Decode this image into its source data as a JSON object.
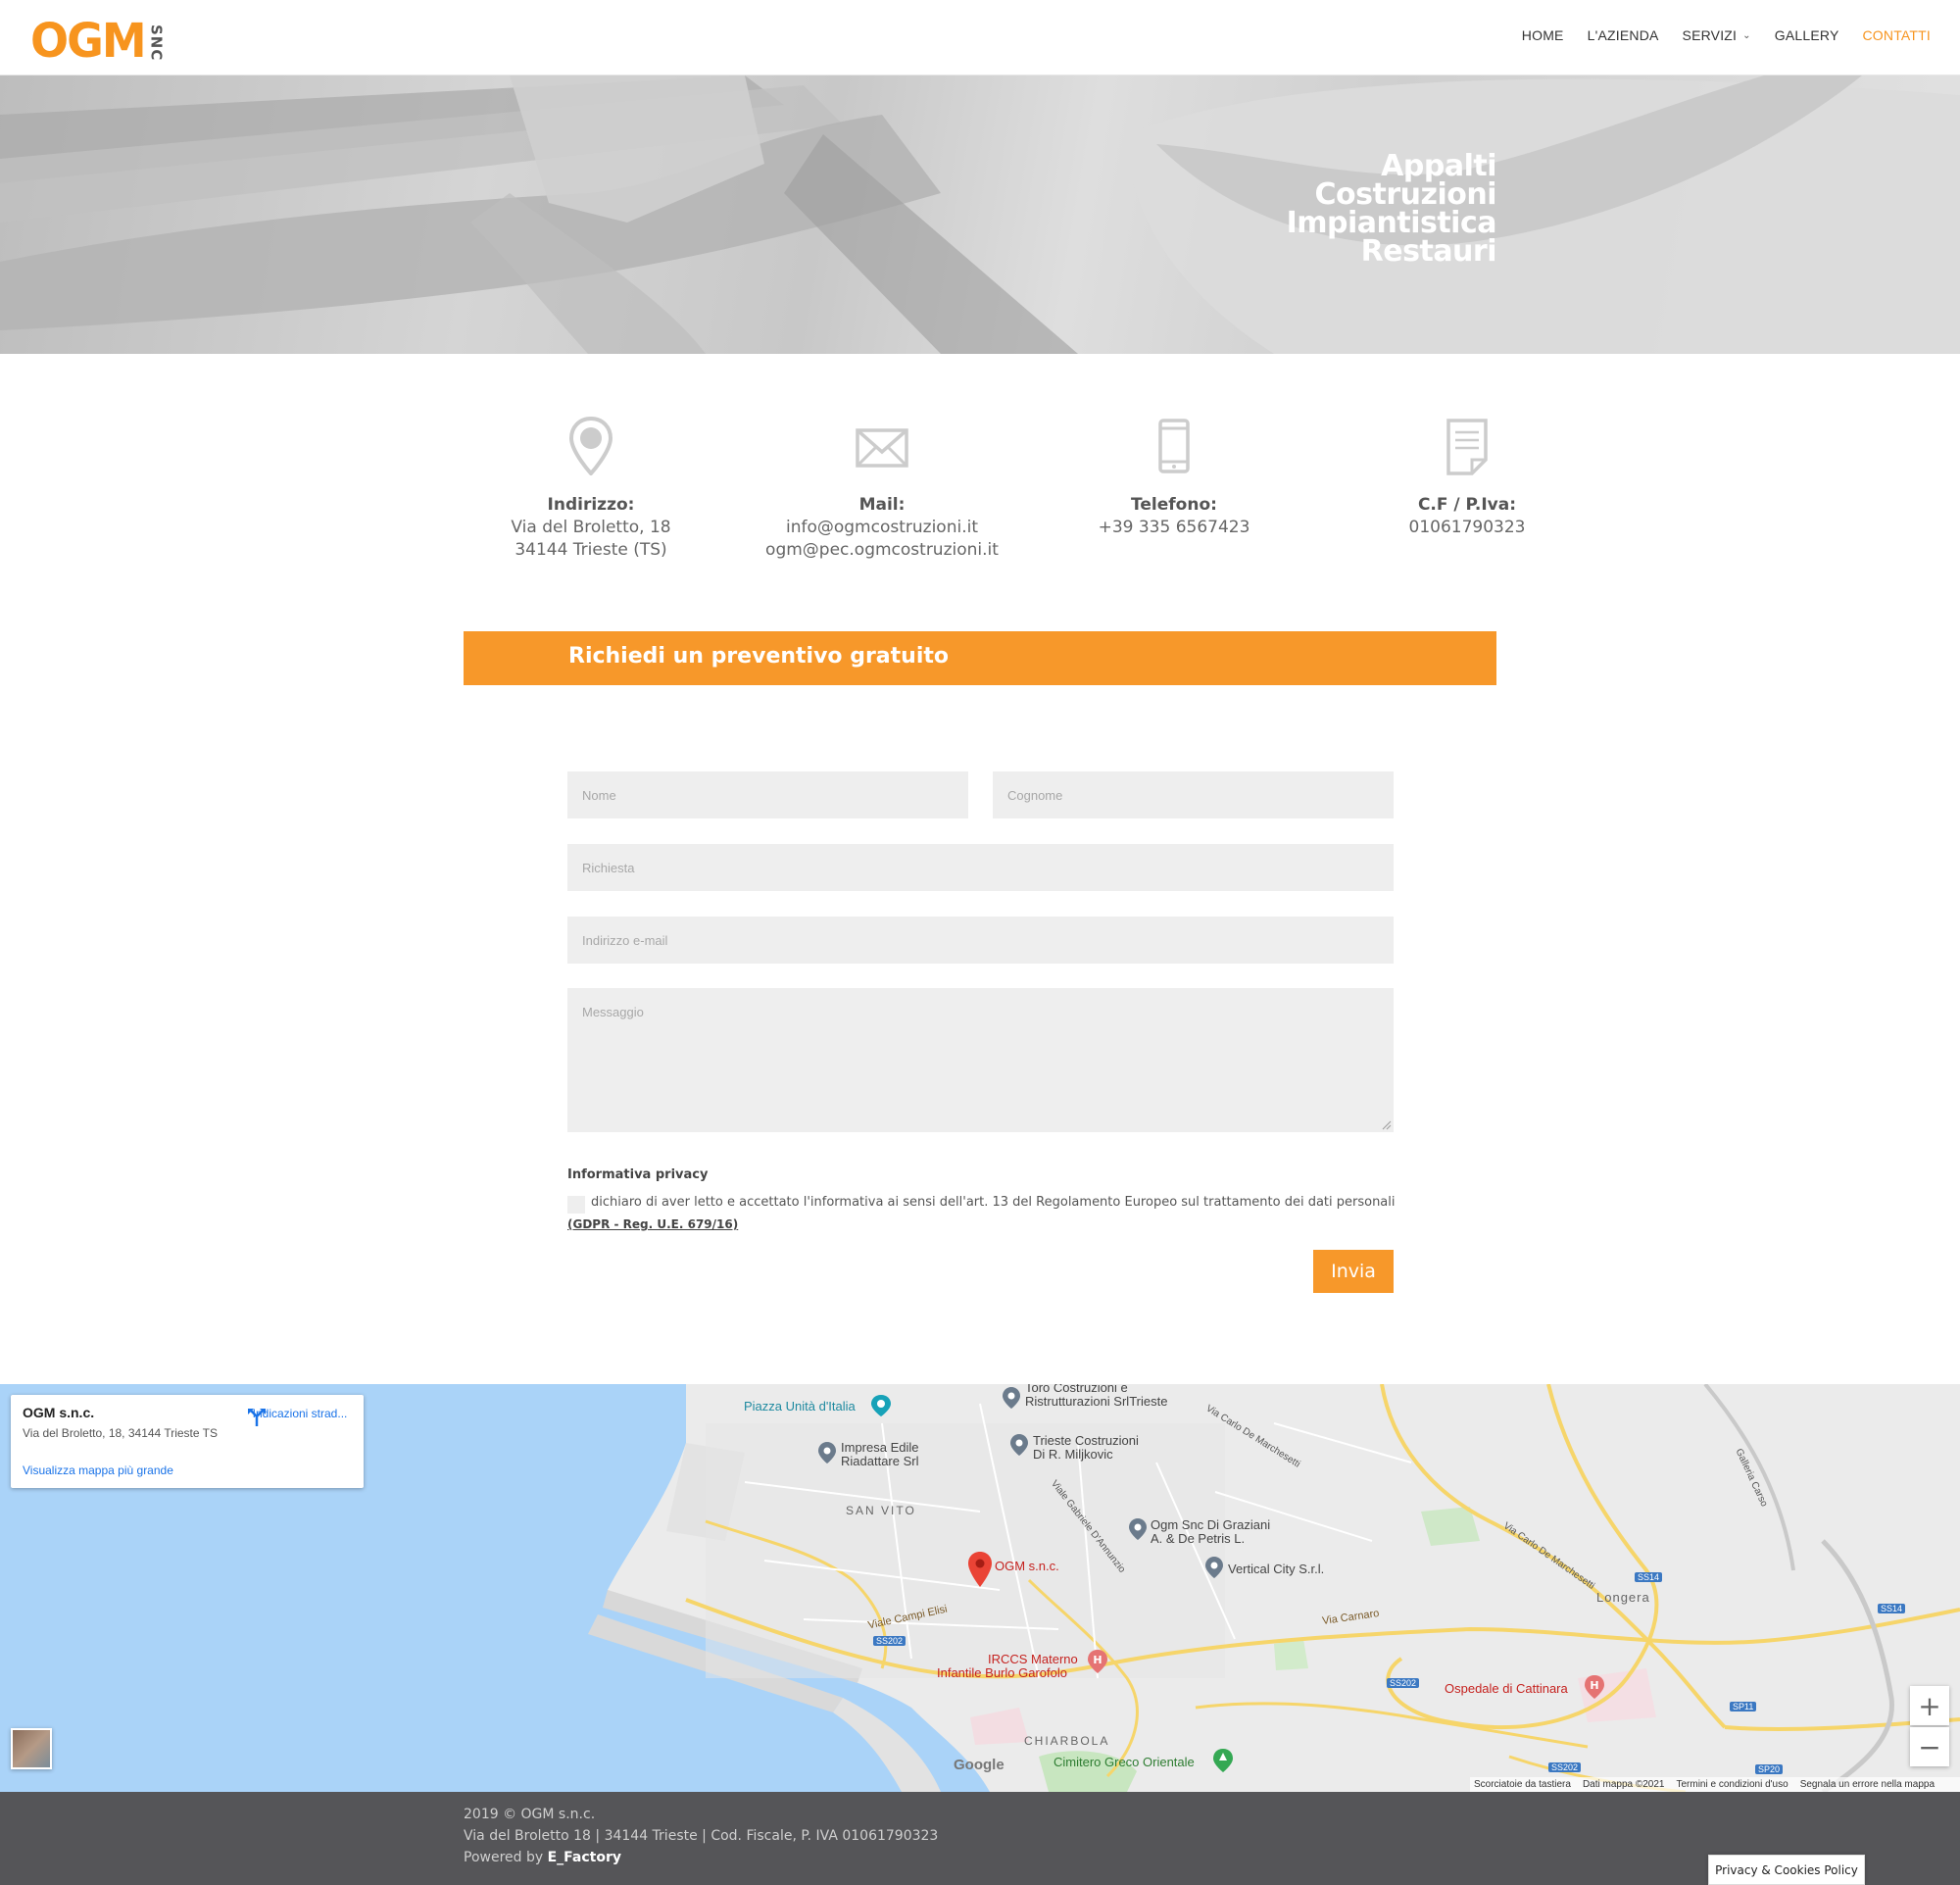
{
  "brand": {
    "logo_text": "OGM",
    "logo_sub": "SNC",
    "accent": "#f7941e",
    "banner_color": "#f7982a"
  },
  "nav": {
    "items": [
      {
        "label": "HOME"
      },
      {
        "label": "L'AZIENDA"
      },
      {
        "label": "SERVIZI"
      },
      {
        "label": "GALLERY"
      },
      {
        "label": "CONTATTI"
      }
    ],
    "active": "CONTATTI"
  },
  "hero": {
    "lines": [
      "Appalti",
      "Costruzioni",
      "Impiantistica",
      "Restauri"
    ]
  },
  "info": {
    "address": {
      "icon": "map-pin-icon",
      "label": "Indirizzo:",
      "line1": "Via del Broletto, 18",
      "line2": "34144 Trieste (TS)"
    },
    "mail": {
      "icon": "envelope-icon",
      "label": "Mail:",
      "line1": "info@ogmcostruzioni.it",
      "line2": "ogm@pec.ogmcostruzioni.it"
    },
    "phone": {
      "icon": "phone-icon",
      "label": "Telefono:",
      "line1": "+39 335 6567423"
    },
    "vat": {
      "icon": "document-icon",
      "label": "C.F / P.Iva:",
      "line1": "01061790323"
    }
  },
  "banner": {
    "title": "Richiedi un preventivo gratuito"
  },
  "form": {
    "nome": {
      "placeholder": "Nome",
      "value": ""
    },
    "cognome": {
      "placeholder": "Cognome",
      "value": ""
    },
    "richiesta": {
      "placeholder": "Richiesta",
      "value": ""
    },
    "email": {
      "placeholder": "Indirizzo e-mail",
      "value": ""
    },
    "messaggio": {
      "placeholder": "Messaggio",
      "value": ""
    },
    "privacy_title": "Informativa privacy",
    "privacy_text": "dichiaro di aver letto e accettato l'informativa ai sensi dell'art. 13 del Regolamento Europeo sul trattamento dei dati personali",
    "privacy_link": "(GDPR - Reg. U.E. 679/16)",
    "privacy_checked": false,
    "submit_label": "Invia"
  },
  "map": {
    "card": {
      "name": "OGM s.n.c.",
      "address": "Via del Broletto, 18, 34144 Trieste TS",
      "directions": "Indicazioni strad...",
      "larger_map": "Visualizza mappa più grande"
    },
    "labels": {
      "piazza": "Piazza Unità d'Italia",
      "toro": "Toro Costruzioni e",
      "toro2": "Ristrutturazioni SrlTrieste",
      "impresa": "Impresa Edile",
      "impresa2": "Riadattare Srl",
      "trieste_costr": "Trieste Costruzioni",
      "trieste_costr2": "Di R. Miljkovic",
      "san_vito": "SAN VITO",
      "ogm_graziani": "Ogm Snc Di Graziani",
      "ogm_graziani2": "A. & De Petris L.",
      "ogm_pin": "OGM s.n.c.",
      "vertical": "Vertical City S.r.l.",
      "longera": "Longera",
      "campi_elisi": "Viale Campi Elisi",
      "carnaro": "Via Carnaro",
      "irccs": "IRCCS Materno",
      "irccs2": "Infantile Burlo Garofolo",
      "cattinara": "Ospedale di Cattinara",
      "chiarbola": "CHIARBOLA",
      "cimitero": "Cimitero Greco Orientale",
      "galleria": "Galleria Carso",
      "marchesetti": "Via Carlo De Marchesetti",
      "marchesetti2": "Via Carlo De Marchesetti",
      "dannunzio": "Viale Gabriele D'Annunzio",
      "ss202a": "SS202",
      "ss202b": "SS202",
      "ss202c": "SS202",
      "ss14a": "SS14",
      "ss14b": "SS14",
      "sp11": "SP11",
      "sp20": "SP20"
    },
    "footer": {
      "shortcuts": "Scorciatoie da tastiera",
      "data": "Dati mappa ©2021",
      "terms": "Termini e condizioni d'uso",
      "report": "Segnala un errore nella mappa"
    },
    "google": "Google",
    "zoom_in": "+",
    "zoom_out": "−"
  },
  "footer": {
    "line1": "2019 © OGM s.n.c.",
    "line2": "Via del Broletto 18 | 34144 Trieste | Cod. Fiscale, P. IVA 01061790323",
    "powered_prefix": "Powered by ",
    "powered_by": "E_Factory",
    "cookie": "Privacy & Cookies Policy"
  }
}
